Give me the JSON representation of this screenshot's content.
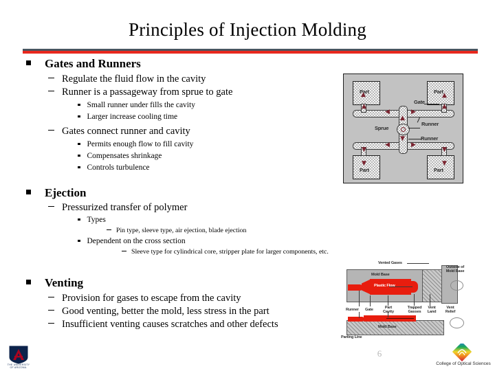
{
  "slide": {
    "title": "Principles of Injection Molding",
    "page_number": "6",
    "accent_top_color": "#4a5560",
    "accent_bottom_color": "#e8281e"
  },
  "content": {
    "sections": [
      {
        "heading": "Gates and Runners",
        "level2": [
          "Regulate the fluid flow in the cavity",
          "Runner is a passageway from sprue to gate"
        ],
        "level3a": [
          "Small runner under fills the cavity",
          "Larger increase cooling time"
        ],
        "level2b": "Gates connect runner and cavity",
        "level3b": [
          "Permits enough flow to fill cavity",
          "Compensates shrinkage",
          "Controls turbulence"
        ]
      },
      {
        "heading": "Ejection",
        "level2": "Pressurized transfer of polymer",
        "level3a": "Types",
        "level4a": "Pin type, sleeve type, air ejection, blade ejection",
        "level3b": "Dependent on the cross section",
        "level4b": "Sleeve type for cylindrical core, stripper plate for larger components, etc."
      },
      {
        "heading": "Venting",
        "level2": [
          "Provision for gases to escape from the cavity",
          "Good venting, better the mold, less stress in the part",
          "Insufficient venting causes scratches and other defects"
        ]
      }
    ]
  },
  "runner_figure": {
    "parts": [
      "Part",
      "Part",
      "Part",
      "Part"
    ],
    "labels": {
      "gate": "Gate",
      "runner_upper": "Runner",
      "runner_lower": "Runner",
      "sprue": "Sprue"
    },
    "background_color": "#c2c2c2",
    "arrow_color": "#7a2430"
  },
  "venting_figure": {
    "labels": {
      "vented_gases": "Vented Gases",
      "mold_base_top": "Mold Base",
      "mold_base_bottom": "Mold Base",
      "outside_of_mold_base": "Outside of Mold Base",
      "plastic_flow": "Plastic Flow",
      "runner": "Runner",
      "gate": "Gate",
      "part_cavity": "Part Cavity",
      "trapped_gasses": "Trapped Gasses",
      "vent_land": "Vent Land",
      "vent_relief": "Vent Relief",
      "parting_line": "Parting Line"
    },
    "plastic_color": "#e81d0e",
    "mold_color": "#b5b5b5"
  },
  "footer": {
    "ua_logo_letter": "A",
    "ua_logo_caption_line1": "THE UNIVERSITY",
    "ua_logo_caption_line2": "OF ARIZONA.",
    "cos_logo_caption": "College of Optical Sciences"
  }
}
